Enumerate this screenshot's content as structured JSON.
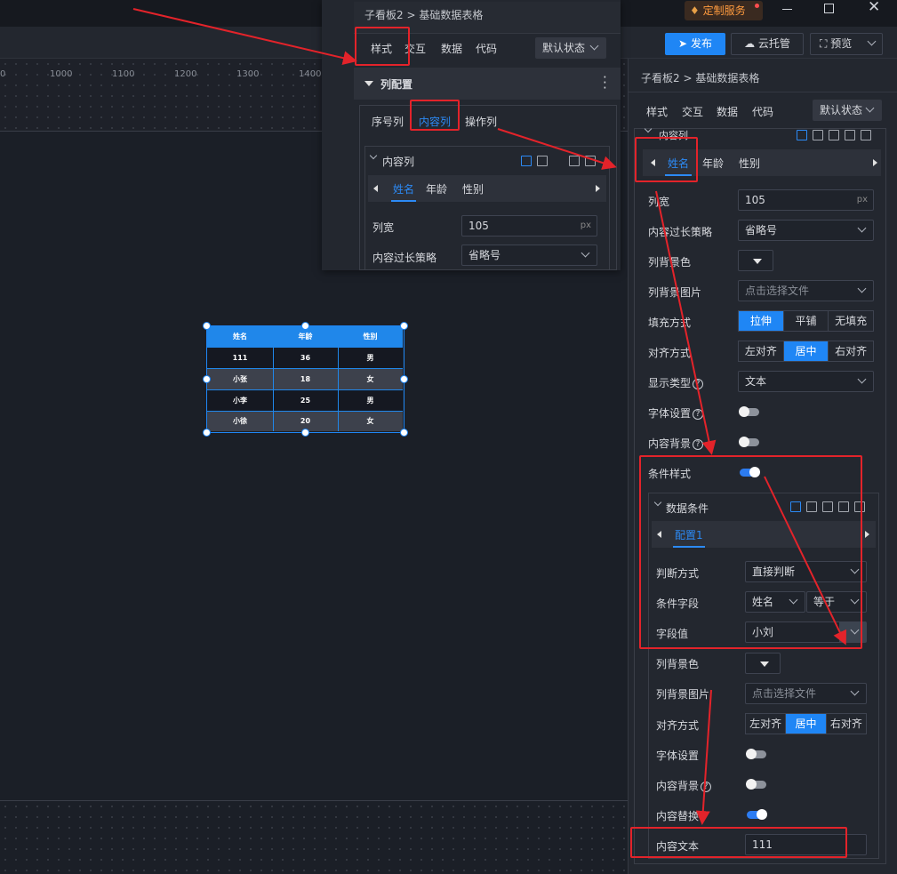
{
  "top": {
    "service": "定制服务",
    "publish": "发布",
    "cloud": "云托管",
    "preview": "预览"
  },
  "ruler": {
    "ticks": [
      "1000",
      "1100",
      "1200",
      "1300",
      "1400"
    ],
    "rtick": "0"
  },
  "popup": {
    "breadcrumb": "子看板2 > 基础数据表格",
    "tabs": [
      "样式",
      "交互",
      "数据",
      "代码"
    ],
    "state": "默认状态",
    "section": "列配置",
    "subtabs": [
      "序号列",
      "内容列",
      "操作列"
    ],
    "group": "内容列",
    "coltabs": [
      "姓名",
      "年龄",
      "性别"
    ],
    "rows": [
      {
        "label": "列宽",
        "value": "105",
        "unit": "px"
      },
      {
        "label": "内容过长策略",
        "value": "省略号"
      }
    ]
  },
  "table": {
    "headers": [
      "姓名",
      "年龄",
      "性别"
    ],
    "rows": [
      [
        "111",
        "36",
        "男"
      ],
      [
        "小张",
        "18",
        "女"
      ],
      [
        "小李",
        "25",
        "男"
      ],
      [
        "小徐",
        "20",
        "女"
      ]
    ]
  },
  "panel": {
    "breadcrumb": "子看板2 > 基础数据表格",
    "tabs": [
      "样式",
      "交互",
      "数据",
      "代码"
    ],
    "state": "默认状态",
    "group": "内容列",
    "coltabs": [
      "姓名",
      "年龄",
      "性别"
    ],
    "width_label": "列宽",
    "width_value": "105",
    "width_unit": "px",
    "overflow_label": "内容过长策略",
    "overflow_value": "省略号",
    "bgcolor_label": "列背景色",
    "bgimg_label": "列背景图片",
    "bgimg_placeholder": "点击选择文件",
    "fill_label": "填充方式",
    "fill_opts": [
      "拉伸",
      "平铺",
      "无填充"
    ],
    "align_label": "对齐方式",
    "align_opts": [
      "左对齐",
      "居中",
      "右对齐"
    ],
    "display_label": "显示类型",
    "display_value": "文本",
    "font_label": "字体设置",
    "cbg_label": "内容背景",
    "cond_label": "条件样式",
    "data_cond": "数据条件",
    "config_tab": "配置1",
    "judge_label": "判断方式",
    "judge_value": "直接判断",
    "field_label": "条件字段",
    "field_value": "姓名",
    "op_value": "等于",
    "fval_label": "字段值",
    "fval_value": "小刘",
    "c_bgcolor_label": "列背景色",
    "c_bgimg_label": "列背景图片",
    "c_bgimg_placeholder": "点击选择文件",
    "c_align_label": "对齐方式",
    "c_align_opts": [
      "左对齐",
      "居中",
      "右对齐"
    ],
    "c_font_label": "字体设置",
    "c_cbg_label": "内容背景",
    "c_replace_label": "内容替换",
    "c_text_label": "内容文本",
    "c_text_value": "111"
  },
  "colors": {
    "accent": "#1f86f5",
    "annotation": "#e3232a"
  }
}
